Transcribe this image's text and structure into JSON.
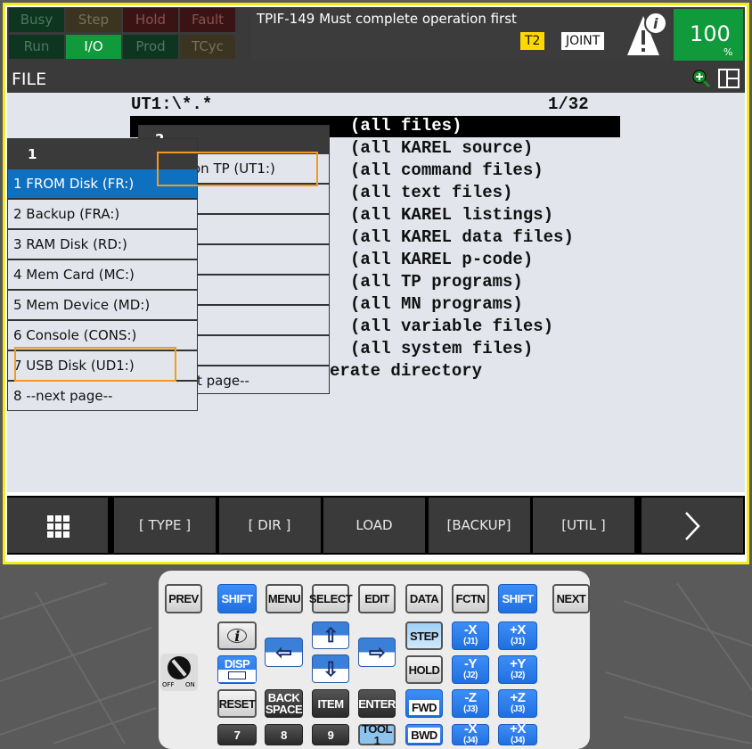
{
  "status_lamps": [
    {
      "label": "Busy",
      "bg": "#0d3520",
      "fg": "#4c7a5c"
    },
    {
      "label": "Step",
      "bg": "#3a3420",
      "fg": "#7a7058"
    },
    {
      "label": "Hold",
      "bg": "#3a1414",
      "fg": "#8a5050"
    },
    {
      "label": "Fault",
      "bg": "#3a1414",
      "fg": "#8a5050"
    },
    {
      "label": "Run",
      "bg": "#0d3520",
      "fg": "#4c7a5c"
    },
    {
      "label": "I/O",
      "bg": "#119a3c",
      "fg": "#ffffff"
    },
    {
      "label": "Prod",
      "bg": "#0d3520",
      "fg": "#4c7a5c"
    },
    {
      "label": "TCyc",
      "bg": "#3a3420",
      "fg": "#7a7058"
    }
  ],
  "message": "TPIF-149 Must complete operation first",
  "mode_badge": "T2",
  "coord_badge": "JOINT",
  "override": {
    "value": "100",
    "unit": "%"
  },
  "screen": {
    "title": "FILE",
    "path": "UT1:\\*.*",
    "page": "1/32"
  },
  "file_rows": [
    "(all files)",
    "(all KAREL source)",
    "(all command files)",
    "(all text files)",
    "(all KAREL listings)",
    "(all KAREL data files)",
    "(all KAREL p-code)",
    "(all TP programs)",
    "(all MN programs)",
    "(all variable files)",
    "(all system files)"
  ],
  "file_row_last": "erate directory",
  "menu1": {
    "header": "1",
    "items": [
      "1 FROM Disk (FR:)",
      "2 Backup (FRA:)",
      "3 RAM Disk (RD:)",
      "4 Mem Card (MC:)",
      "5 Mem Device (MD:)",
      "6 Console (CONS:)",
      "7 USB Disk (UD1:)",
      "8 --next page--"
    ],
    "selected": 0
  },
  "menu2": {
    "header": "2",
    "item_first": "on TP (UT1:)",
    "item_last": "t page--"
  },
  "function_keys": [
    "[ TYPE ]",
    "[ DIR ]",
    "LOAD",
    "[BACKUP]",
    "[UTIL ]"
  ],
  "keypad": {
    "prev": "PREV",
    "shift": "SHIFT",
    "menu": "MENU",
    "select": "SELECT",
    "edit": "EDIT",
    "data": "DATA",
    "fctn": "FCTN",
    "next": "NEXT",
    "info": "i",
    "disp": "DISP",
    "step": "STEP",
    "hold": "HOLD",
    "reset": "RESET",
    "back1": "BACK",
    "back2": "SPACE",
    "item": "ITEM",
    "enter": "ENTER",
    "fwd": "FWD",
    "bwd": "BWD",
    "n7": "7",
    "n8": "8",
    "n9": "9",
    "tool1": "TOOL",
    "tool2": "1",
    "jog": [
      [
        "-X",
        "(J1)"
      ],
      [
        "+X",
        "(J1)"
      ],
      [
        "-Y",
        "(J2)"
      ],
      [
        "+Y",
        "(J2)"
      ],
      [
        "-Z",
        "(J3)"
      ],
      [
        "+Z",
        "(J3)"
      ],
      [
        "-X",
        "(J4)"
      ],
      [
        "+X",
        "(J4)"
      ]
    ],
    "switch_off": "OFF",
    "switch_on": "ON"
  }
}
